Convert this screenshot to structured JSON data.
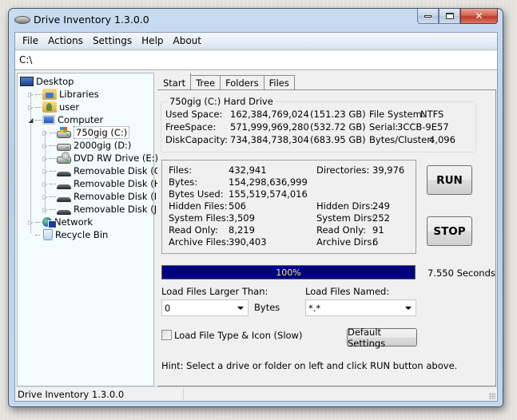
{
  "window": {
    "title": "Drive Inventory 1.3.0.0",
    "controls": {
      "minimize": "minimize",
      "maximize": "maximize",
      "close": "✕"
    }
  },
  "menu": {
    "items": [
      "File",
      "Actions",
      "Settings",
      "Help",
      "About"
    ]
  },
  "path": {
    "value": "C:\\"
  },
  "tree": {
    "items": [
      {
        "label": "Desktop",
        "icon": "desktop-icon",
        "level": 0
      },
      {
        "label": "Libraries",
        "icon": "libraries-icon",
        "level": 1,
        "expander": "collapsed"
      },
      {
        "label": "user",
        "icon": "user-folder-icon",
        "level": 1,
        "expander": "collapsed"
      },
      {
        "label": "Computer",
        "icon": "computer-icon",
        "level": 1,
        "expander": "expanded"
      },
      {
        "label": "750gig (C:)",
        "icon": "system-drive-icon",
        "level": 2,
        "expander": "collapsed",
        "selected": true
      },
      {
        "label": "2000gig (D:)",
        "icon": "hard-drive-icon",
        "level": 2,
        "expander": "collapsed"
      },
      {
        "label": "DVD RW Drive (E:)",
        "icon": "dvd-drive-icon",
        "level": 2,
        "expander": "collapsed"
      },
      {
        "label": "Removable Disk (G:)",
        "icon": "removable-disk-icon",
        "level": 2,
        "expander": "collapsed"
      },
      {
        "label": "Removable Disk (H:)",
        "icon": "removable-disk-icon",
        "level": 2,
        "expander": "collapsed"
      },
      {
        "label": "Removable Disk (I:)",
        "icon": "removable-disk-icon",
        "level": 2,
        "expander": "collapsed"
      },
      {
        "label": "Removable Disk (J:)",
        "icon": "removable-disk-icon",
        "level": 2,
        "expander": "collapsed"
      },
      {
        "label": "Network",
        "icon": "network-icon",
        "level": 1,
        "expander": "collapsed"
      },
      {
        "label": "Recycle Bin",
        "icon": "recycle-bin-icon",
        "level": 1
      }
    ]
  },
  "tabs": {
    "items": [
      "Start",
      "Tree",
      "Folders",
      "Files"
    ],
    "active": "Start"
  },
  "drive_info": {
    "title": "750gig (C:)  Hard Drive",
    "used_label": "Used Space:",
    "used_bytes": "162,384,769,024",
    "used_gb": "(151.23 GB)",
    "free_label": "FreeSpace:",
    "free_bytes": "571,999,969,280",
    "free_gb": "(532.72 GB)",
    "capacity_label": "DiskCapacity:",
    "capacity_bytes": "734,384,738,304",
    "capacity_gb": "(683.95 GB)",
    "fs_label": "File System:",
    "fs_value": "NTFS",
    "serial_label": "Serial:",
    "serial_value": "3CCB-9E57",
    "cluster_label": "Bytes/Cluster:",
    "cluster_value": "4,096"
  },
  "stats": {
    "files_label": "Files:",
    "files": "432,941",
    "bytes_label": "Bytes:",
    "bytes": "154,298,636,999",
    "bytes_used_label": "Bytes Used:",
    "bytes_used": "155,519,574,016",
    "hidden_files_label": "Hidden Files:",
    "hidden_files": "506",
    "system_files_label": "System Files:",
    "system_files": "3,509",
    "read_only_files_label": "Read Only:",
    "read_only_files": "8,219",
    "archive_files_label": "Archive Files:",
    "archive_files": "390,403",
    "directories_label": "Directories:",
    "directories": "39,976",
    "hidden_dirs_label": "Hidden Dirs:",
    "hidden_dirs": "249",
    "system_dirs_label": "System Dirs:",
    "system_dirs": "252",
    "read_only_dirs_label": "Read Only:",
    "read_only_dirs": "91",
    "archive_dirs_label": "Archive Dirs:",
    "archive_dirs": "6"
  },
  "actions": {
    "run_label": "RUN",
    "stop_label": "STOP",
    "elapsed": "7.550 Seconds"
  },
  "progress": {
    "value_percent": 100,
    "label": "100%",
    "fill_color": "#000080",
    "text_color": "#f4f06a"
  },
  "filters": {
    "larger_label": "Load Files Larger Than:",
    "larger_value": "0",
    "larger_unit": "Bytes",
    "named_label": "Load Files Named:",
    "named_value": "*.*"
  },
  "options": {
    "load_icons_label": "Load File Type & Icon (Slow)",
    "load_icons_checked": false,
    "default_settings_label": "Default Settings"
  },
  "hint": "Hint:  Select a drive or folder on left and click RUN button above.",
  "statusbar": {
    "text": "Drive Inventory 1.3.0.0"
  }
}
